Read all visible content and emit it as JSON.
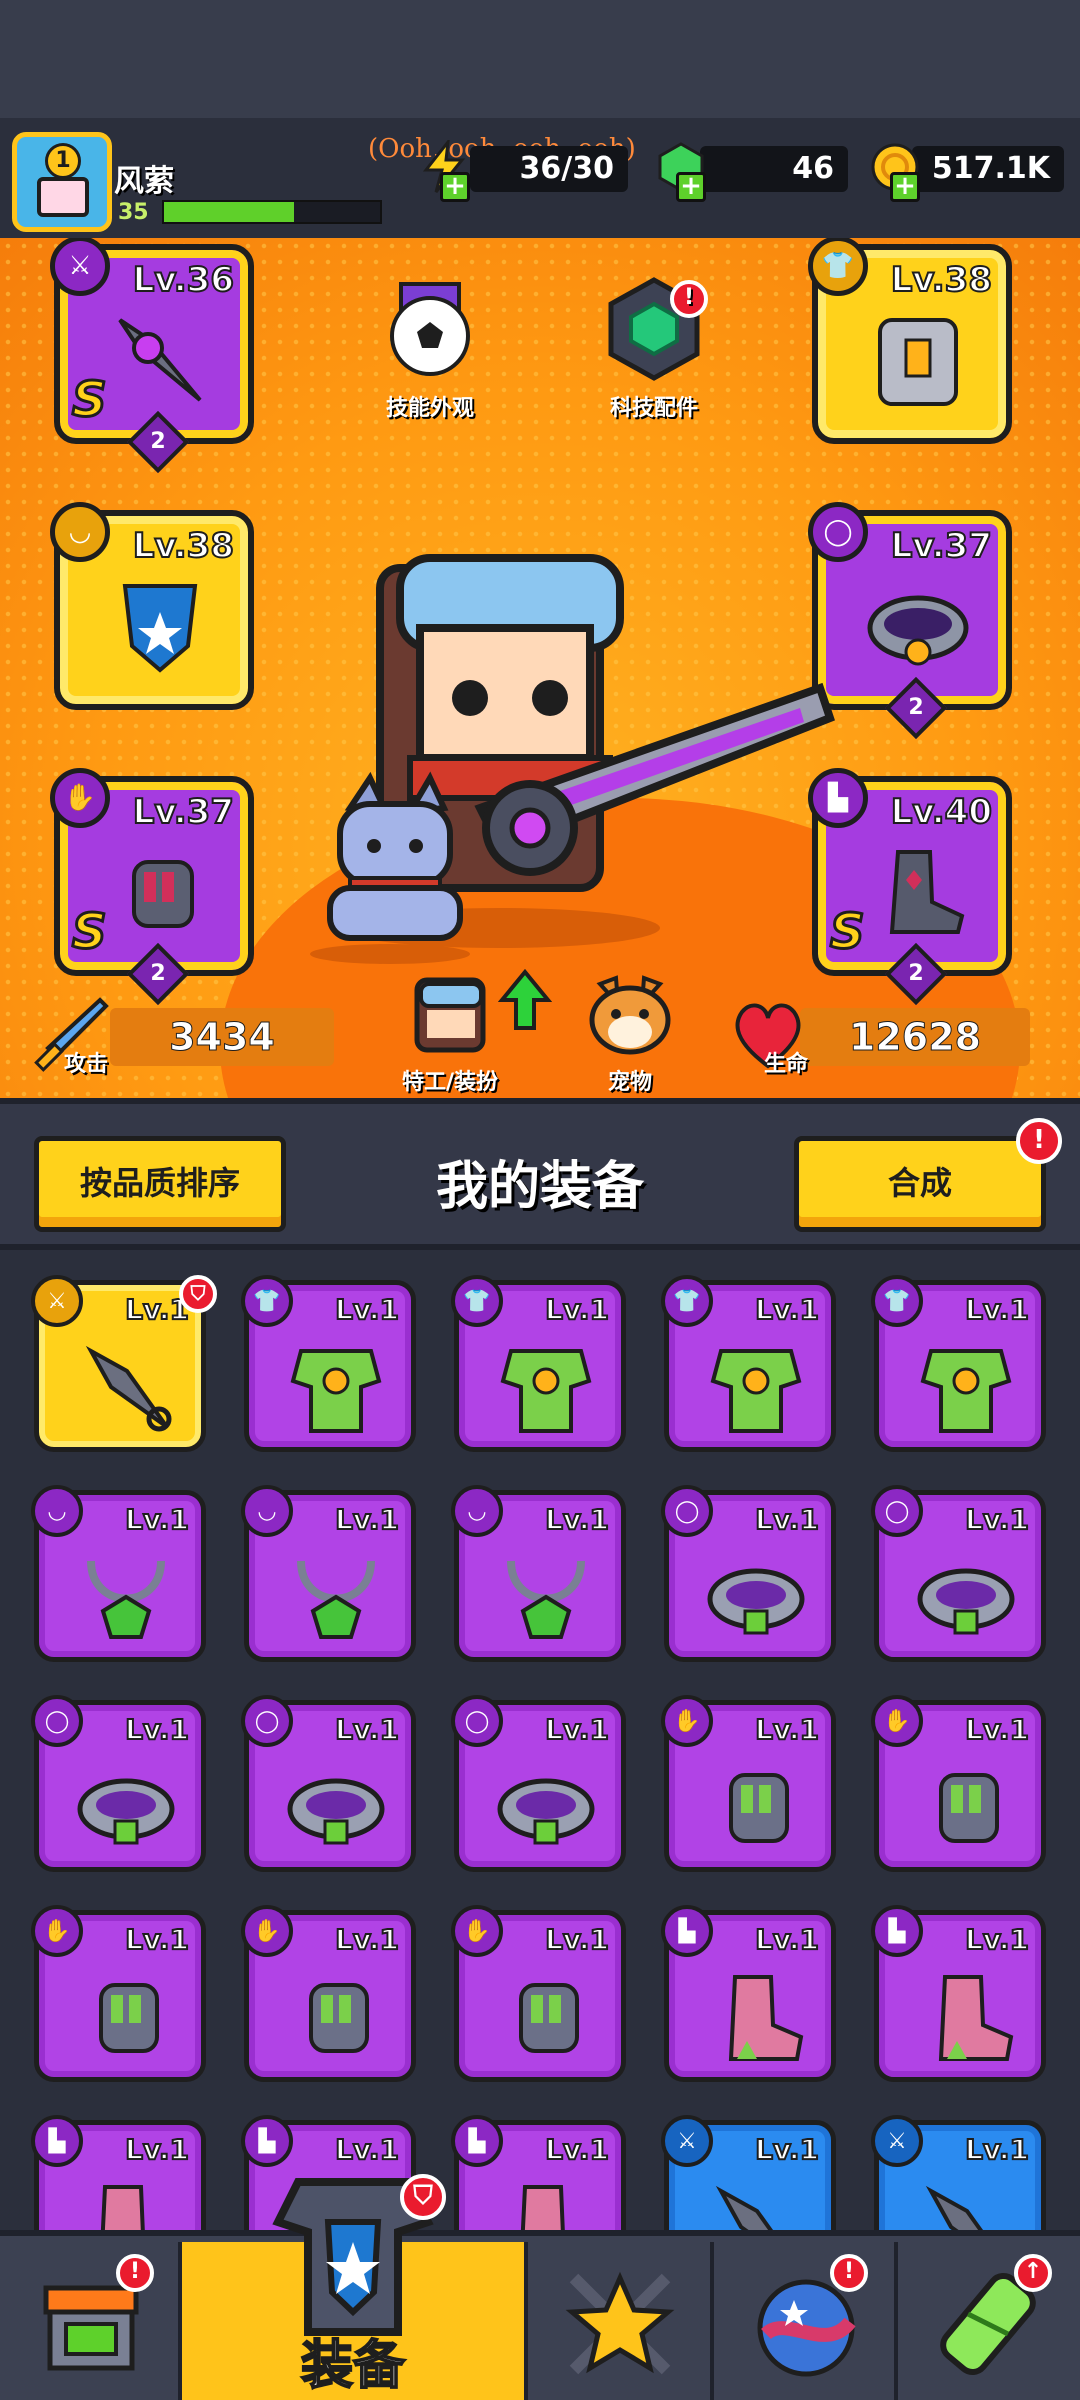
{
  "player": {
    "name": "风萦",
    "level": "35",
    "avatar_badge": "1",
    "xp_fraction": 0.6
  },
  "resources": {
    "energy": "36/30",
    "gems": "46",
    "coins": "517.1K"
  },
  "watermark": "(Ooh, ooh, ooh, ooh)",
  "equipped": [
    {
      "slot": "weapon",
      "level": "Lv.36",
      "rank": "S",
      "stars": "2",
      "frame": "purple",
      "icon": "sword-icon"
    },
    {
      "slot": "armor",
      "level": "Lv.38",
      "frame": "yellow",
      "icon": "shirt-icon"
    },
    {
      "slot": "necklace",
      "level": "Lv.38",
      "frame": "yellow",
      "icon": "necklace-icon"
    },
    {
      "slot": "belt",
      "level": "Lv.37",
      "stars": "2",
      "frame": "purple",
      "icon": "belt-icon"
    },
    {
      "slot": "gloves",
      "level": "Lv.37",
      "rank": "S",
      "stars": "2",
      "frame": "purple",
      "icon": "glove-icon"
    },
    {
      "slot": "boots",
      "level": "Lv.40",
      "rank": "S",
      "stars": "2",
      "frame": "purple",
      "icon": "boot-icon"
    }
  ],
  "center": {
    "skill_skin": "技能外观",
    "tech_parts": "科技配件",
    "agent_outfit": "特工/装扮",
    "pet": "宠物"
  },
  "stats": {
    "attack_label": "攻击",
    "attack": "3434",
    "hp_label": "生命",
    "hp": "12628"
  },
  "inventory_header": {
    "sort": "按品质排序",
    "title": "我的装备",
    "merge": "合成"
  },
  "inventory": [
    {
      "level": "Lv.1",
      "frame": "yellow",
      "type": "weapon",
      "badge": true
    },
    {
      "level": "Lv.1",
      "frame": "purple",
      "type": "armor"
    },
    {
      "level": "Lv.1",
      "frame": "purple",
      "type": "armor"
    },
    {
      "level": "Lv.1",
      "frame": "purple",
      "type": "armor"
    },
    {
      "level": "Lv.1",
      "frame": "purple",
      "type": "armor"
    },
    {
      "level": "Lv.1",
      "frame": "purple",
      "type": "necklace"
    },
    {
      "level": "Lv.1",
      "frame": "purple",
      "type": "necklace"
    },
    {
      "level": "Lv.1",
      "frame": "purple",
      "type": "necklace"
    },
    {
      "level": "Lv.1",
      "frame": "purple",
      "type": "belt"
    },
    {
      "level": "Lv.1",
      "frame": "purple",
      "type": "belt"
    },
    {
      "level": "Lv.1",
      "frame": "purple",
      "type": "belt"
    },
    {
      "level": "Lv.1",
      "frame": "purple",
      "type": "belt"
    },
    {
      "level": "Lv.1",
      "frame": "purple",
      "type": "belt"
    },
    {
      "level": "Lv.1",
      "frame": "purple",
      "type": "gloves"
    },
    {
      "level": "Lv.1",
      "frame": "purple",
      "type": "gloves"
    },
    {
      "level": "Lv.1",
      "frame": "purple",
      "type": "gloves"
    },
    {
      "level": "Lv.1",
      "frame": "purple",
      "type": "gloves"
    },
    {
      "level": "Lv.1",
      "frame": "purple",
      "type": "gloves"
    },
    {
      "level": "Lv.1",
      "frame": "purple",
      "type": "boots"
    },
    {
      "level": "Lv.1",
      "frame": "purple",
      "type": "boots"
    },
    {
      "level": "Lv.1",
      "frame": "purple",
      "type": "boots"
    },
    {
      "level": "Lv.1",
      "frame": "purple",
      "type": "boots"
    },
    {
      "level": "Lv.1",
      "frame": "purple",
      "type": "boots"
    },
    {
      "level": "Lv.1",
      "frame": "blue",
      "type": "weapon"
    },
    {
      "level": "Lv.1",
      "frame": "blue",
      "type": "weapon"
    }
  ],
  "nav": {
    "active_label": "装备"
  },
  "colors": {
    "orange": "#ff9a12",
    "purple": "#b143e6",
    "yellow": "#ffd21b",
    "blue": "#2b8bf0",
    "badge_red": "#ea1b2e"
  }
}
